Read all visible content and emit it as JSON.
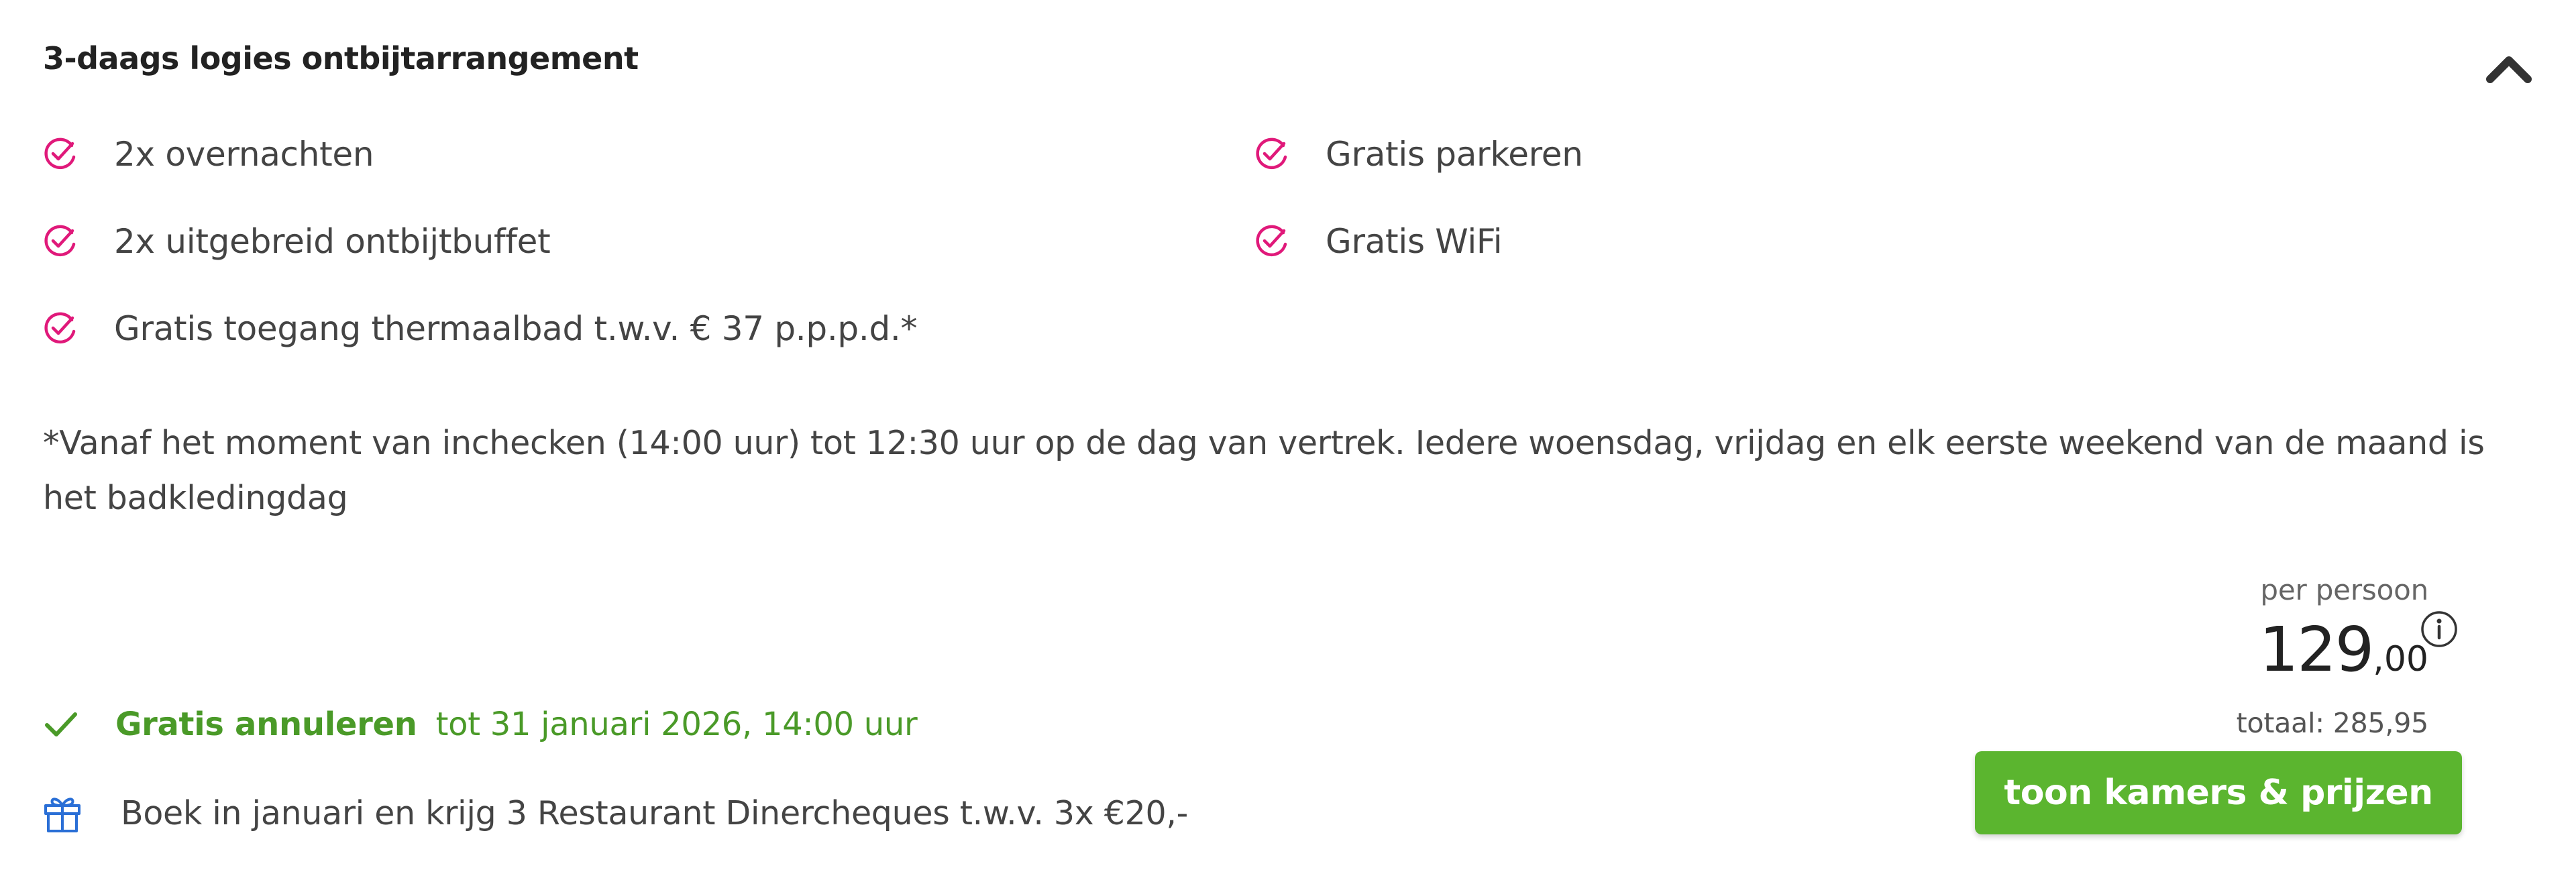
{
  "package": {
    "title": "3-daags logies ontbijtarrangement",
    "collapse_icon": "chevron-up-icon"
  },
  "features": [
    {
      "label": "2x overnachten",
      "icon": "check-circle-icon"
    },
    {
      "label": "Gratis parkeren",
      "icon": "check-circle-icon"
    },
    {
      "label": "2x uitgebreid ontbijtbuffet",
      "icon": "check-circle-icon"
    },
    {
      "label": "Gratis WiFi",
      "icon": "check-circle-icon"
    },
    {
      "label": "Gratis toegang thermaalbad t.w.v. € 37 p.p.p.d.*",
      "icon": "check-circle-icon"
    }
  ],
  "footnote": "*Vanaf het moment van inchecken (14:00 uur) tot 12:30 uur op de dag van vertrek. Iedere woensdag, vrijdag en elk eerste weekend van de maand is het badkledingdag",
  "cancellation": {
    "label": "Gratis annuleren",
    "until": "tot 31 januari 2026, 14:00 uur",
    "icon": "checkmark-icon"
  },
  "promo": {
    "text": "Boek in januari en krijg 3 Restaurant Dinercheques t.w.v. 3x €20,-",
    "icon": "gift-icon"
  },
  "pricing": {
    "per_person_label": "per persoon",
    "price_euros": "129",
    "price_cents": ",00",
    "total": "totaal: 285,95",
    "info_icon": "info-icon"
  },
  "cta": {
    "label": "toon kamers & prijzen"
  },
  "colors": {
    "accent_pink": "#e0197a",
    "success_green": "#4a9a28",
    "button_green": "#5bb52f",
    "gift_blue": "#2a6fd6"
  }
}
